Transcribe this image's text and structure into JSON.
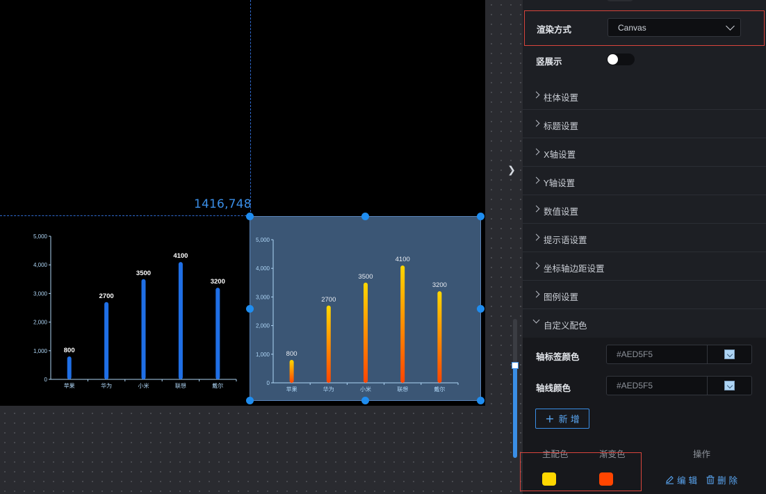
{
  "canvas": {
    "coordinate_readout": "1416,748"
  },
  "chart_data": [
    {
      "type": "bar",
      "categories": [
        "苹果",
        "华为",
        "小米",
        "联想",
        "戴尔"
      ],
      "values": [
        800,
        2700,
        3500,
        4100,
        3200
      ],
      "ylim": [
        0,
        5000
      ],
      "yticks": [
        "0",
        "1,000",
        "2,000",
        "3,000",
        "4,000",
        "5,000"
      ],
      "bar_color": "#1f6fe6",
      "label_color": "#ffffff"
    },
    {
      "type": "bar",
      "categories": [
        "苹果",
        "华为",
        "小米",
        "联想",
        "戴尔"
      ],
      "values": [
        800,
        2700,
        3500,
        4100,
        3200
      ],
      "ylim": [
        0,
        5000
      ],
      "yticks": [
        "0",
        "1,000",
        "2,000",
        "3,000",
        "4,000",
        "5,000"
      ],
      "gradient": [
        "#FFD700",
        "#FF4500"
      ],
      "label_color": "#e8ecf2",
      "selected": true
    }
  ],
  "panel": {
    "render_mode": {
      "label": "渲染方式",
      "value": "Canvas"
    },
    "vertical_display": {
      "label": "竖展示",
      "enabled": false
    },
    "sections": [
      {
        "label": "柱体设置"
      },
      {
        "label": "标题设置"
      },
      {
        "label": "X轴设置"
      },
      {
        "label": "Y轴设置"
      },
      {
        "label": "数值设置"
      },
      {
        "label": "提示语设置"
      },
      {
        "label": "坐标轴边距设置"
      },
      {
        "label": "图例设置"
      },
      {
        "label": "自定义配色",
        "open": true
      }
    ],
    "custom_colors": {
      "axis_label_color": {
        "label": "轴标签颜色",
        "value": "#AED5F5"
      },
      "axis_line_color": {
        "label": "轴线颜色",
        "value": "#AED5F5"
      },
      "add_button": "新 增",
      "table_headers": {
        "main": "主配色",
        "gradient": "渐变色",
        "actions": "操作"
      },
      "rows": [
        {
          "main": "#FFD700",
          "gradient": "#FF4500",
          "edit": "编 辑",
          "delete": "删 除"
        }
      ]
    }
  }
}
